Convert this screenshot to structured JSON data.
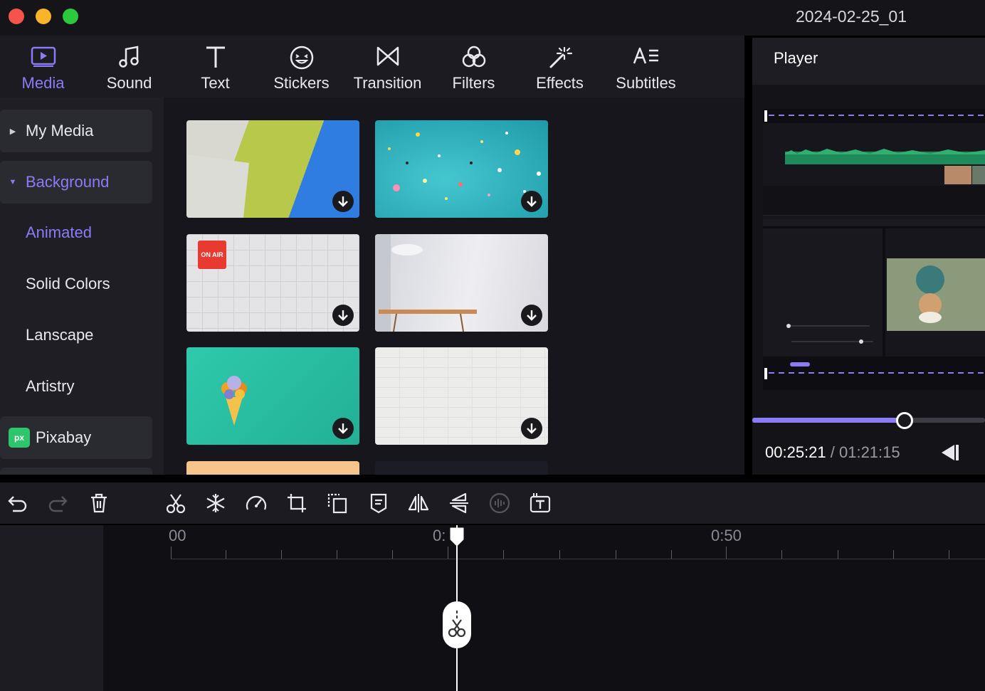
{
  "window": {
    "title": "2024-02-25_01"
  },
  "toolbar": {
    "items": [
      {
        "label": "Media",
        "icon": "media-icon",
        "active": true
      },
      {
        "label": "Sound",
        "icon": "music-note-icon"
      },
      {
        "label": "Text",
        "icon": "text-icon"
      },
      {
        "label": "Stickers",
        "icon": "sticker-icon"
      },
      {
        "label": "Transition",
        "icon": "transition-icon"
      },
      {
        "label": "Filters",
        "icon": "filters-icon"
      },
      {
        "label": "Effects",
        "icon": "magic-wand-icon"
      },
      {
        "label": "Subtitles",
        "icon": "subtitles-icon"
      }
    ]
  },
  "sidebar": {
    "my_media": "My Media",
    "background": "Background",
    "sub": [
      "Animated",
      "Solid Colors",
      "Lanscape",
      "Artistry"
    ],
    "pixabay": "Pixabay",
    "pixabay_logo": "px"
  },
  "thumbnails": {
    "on_air_sign": "ON AIR"
  },
  "player": {
    "title": "Player",
    "current_time": "00:25:21",
    "separator": " / ",
    "total_time": "01:21:15",
    "progress": 0.655
  },
  "timeline": {
    "ruler_labels": [
      "00",
      "0:",
      "0:50"
    ]
  },
  "colors": {
    "accent": "#8b7cf6",
    "background": "#16161c"
  }
}
